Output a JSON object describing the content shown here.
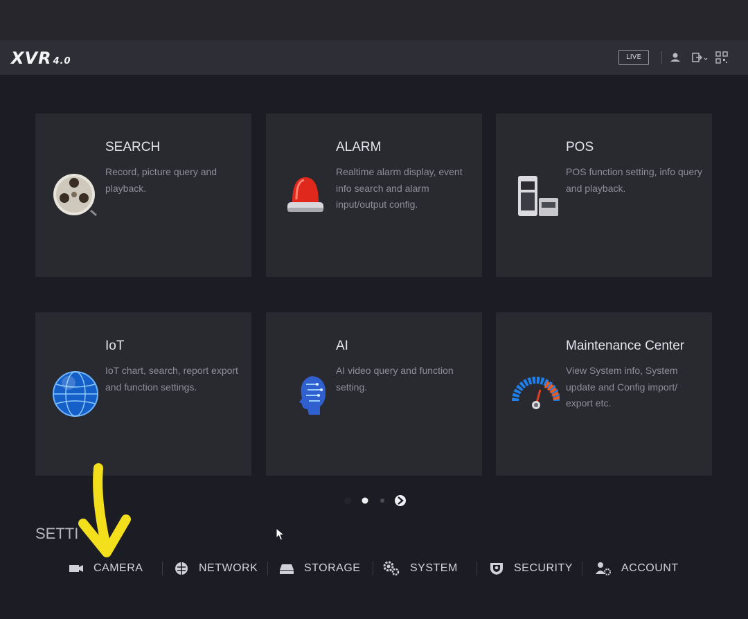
{
  "header": {
    "logo": "XVR",
    "logo_version": "4.0",
    "live_label": "LIVE"
  },
  "cards": [
    {
      "title": "SEARCH",
      "desc": "Record, picture query and playback.",
      "icon": "film-reel-icon"
    },
    {
      "title": "ALARM",
      "desc": "Realtime alarm display, event info search and alarm input/output config.",
      "icon": "alarm-siren-icon"
    },
    {
      "title": "POS",
      "desc": "POS function setting, info query and playback.",
      "icon": "pos-terminal-icon"
    },
    {
      "title": "IoT",
      "desc": "IoT chart, search, report export and function settings.",
      "icon": "globe-icon"
    },
    {
      "title": "AI",
      "desc": "AI video query and function setting.",
      "icon": "ai-head-icon"
    },
    {
      "title": "Maintenance Center",
      "desc": "View System info, System update and Config import/ export etc.",
      "icon": "gauge-icon"
    }
  ],
  "pagination": {
    "current": 2,
    "total": 3
  },
  "settings": {
    "title": "SETTI",
    "items": [
      {
        "label": "CAMERA",
        "icon": "camera-icon"
      },
      {
        "label": "NETWORK",
        "icon": "network-icon"
      },
      {
        "label": "STORAGE",
        "icon": "storage-icon"
      },
      {
        "label": "SYSTEM",
        "icon": "gears-icon"
      },
      {
        "label": "SECURITY",
        "icon": "shield-icon"
      },
      {
        "label": "ACCOUNT",
        "icon": "user-gear-icon"
      }
    ]
  },
  "colors": {
    "background": "#1c1c24",
    "card": "#292930",
    "annotation_arrow": "#f3df1c"
  }
}
